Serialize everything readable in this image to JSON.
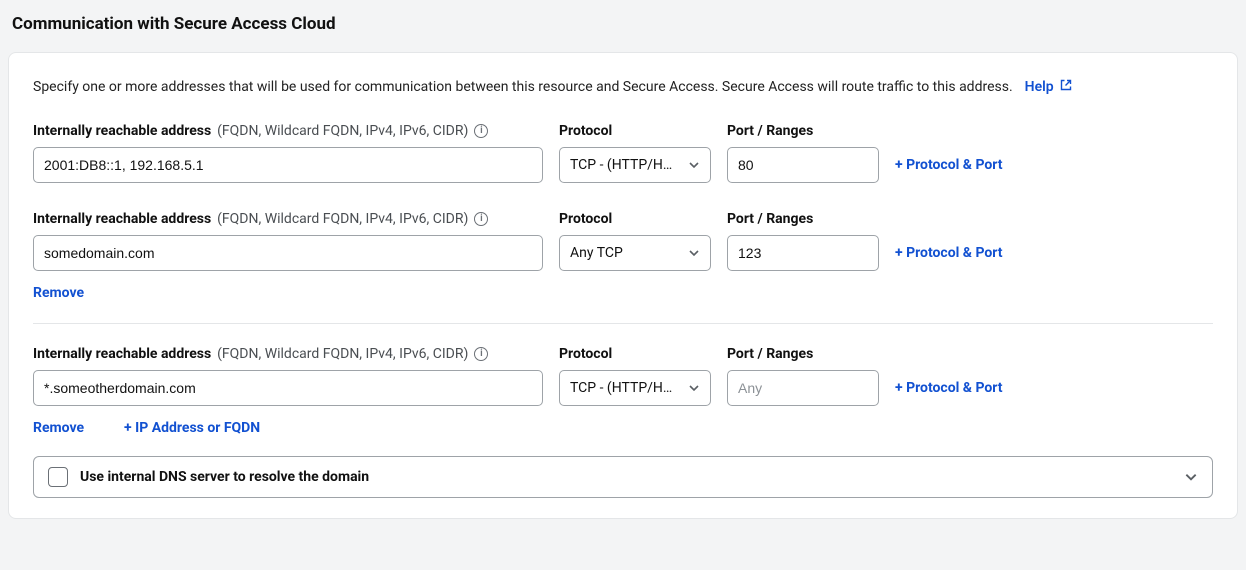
{
  "section_title": "Communication with Secure Access Cloud",
  "intro": "Specify one or more addresses that will be used for communication between this resource and Secure Access. Secure Access will route traffic to this address.",
  "help_label": "Help",
  "labels": {
    "address": "Internally reachable address",
    "address_sub": "(FQDN, Wildcard FQDN, IPv4, IPv6, CIDR)",
    "protocol": "Protocol",
    "port": "Port / Ranges"
  },
  "buttons": {
    "add_protocol_port": "+ Protocol & Port",
    "remove": "Remove",
    "add_ip_fqdn": "+ IP Address or FQDN"
  },
  "port_placeholder": "Any",
  "rows": [
    {
      "address": "2001:DB8::1, 192.168.5.1",
      "protocol": "TCP - (HTTP/H…",
      "port": "80"
    },
    {
      "address": "somedomain.com",
      "protocol": "Any TCP",
      "port": "123"
    },
    {
      "address": "*.someotherdomain.com",
      "protocol": "TCP - (HTTP/H…",
      "port": ""
    }
  ],
  "dns_checkbox_label": "Use internal DNS server to resolve the domain"
}
